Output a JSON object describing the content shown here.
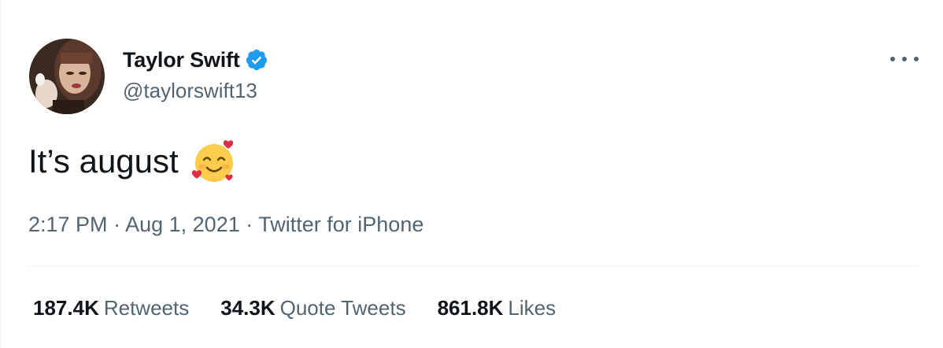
{
  "author": {
    "display_name": "Taylor Swift",
    "handle": "@taylorswift13",
    "verified": true
  },
  "tweet": {
    "text": "It’s august",
    "emoji": "smiling-face-with-hearts"
  },
  "meta": {
    "time": "2:17 PM",
    "separator": "·",
    "date": "Aug 1, 2021",
    "source": "Twitter for iPhone"
  },
  "stats": {
    "retweets_count": "187.4K",
    "retweets_label": "Retweets",
    "quote_count": "34.3K",
    "quote_label": "Quote Tweets",
    "likes_count": "861.8K",
    "likes_label": "Likes"
  },
  "icons": {
    "verified": "verified-badge-icon",
    "more": "more-options-icon"
  },
  "colors": {
    "text_primary": "#0f1419",
    "text_secondary": "#536471",
    "verified_blue": "#1d9bf0",
    "divider": "#eff3f4"
  }
}
